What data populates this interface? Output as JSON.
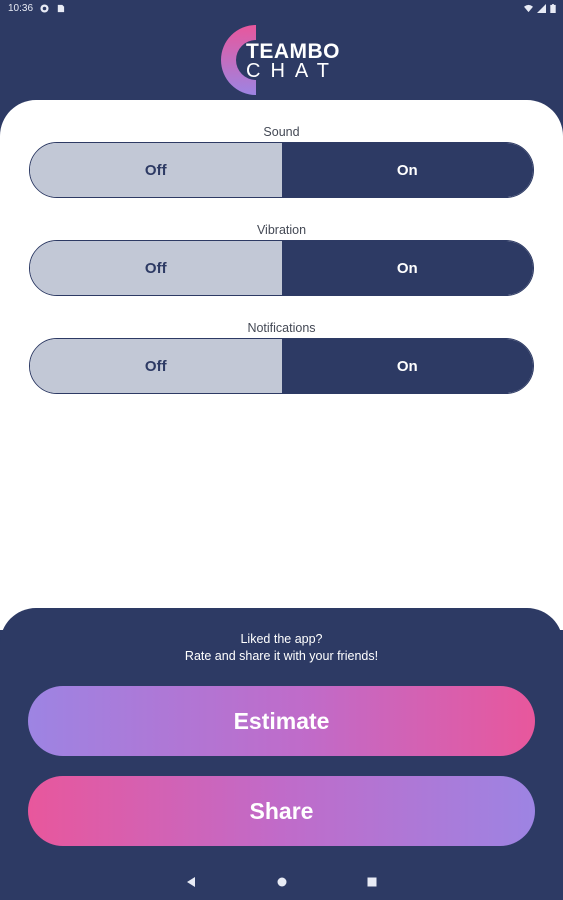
{
  "status_bar": {
    "time": "10:36"
  },
  "header": {
    "logo_word1": "TEAMBO",
    "logo_word2": "CHAT"
  },
  "settings": [
    {
      "label": "Sound",
      "off_label": "Off",
      "on_label": "On",
      "selected": "On"
    },
    {
      "label": "Vibration",
      "off_label": "Off",
      "on_label": "On",
      "selected": "On"
    },
    {
      "label": "Notifications",
      "off_label": "Off",
      "on_label": "On",
      "selected": "On"
    }
  ],
  "promo": {
    "line1": "Liked the app?",
    "line2": "Rate and share it with your friends!",
    "estimate_label": "Estimate",
    "share_label": "Share"
  },
  "nav": {
    "icons": [
      "back-icon",
      "home-icon",
      "recents-icon"
    ]
  },
  "colors": {
    "primary": "#2d3a64",
    "off_segment": "#c2c8d6",
    "gradient_purple": "#9d84e3",
    "gradient_pink": "#e8579c"
  }
}
